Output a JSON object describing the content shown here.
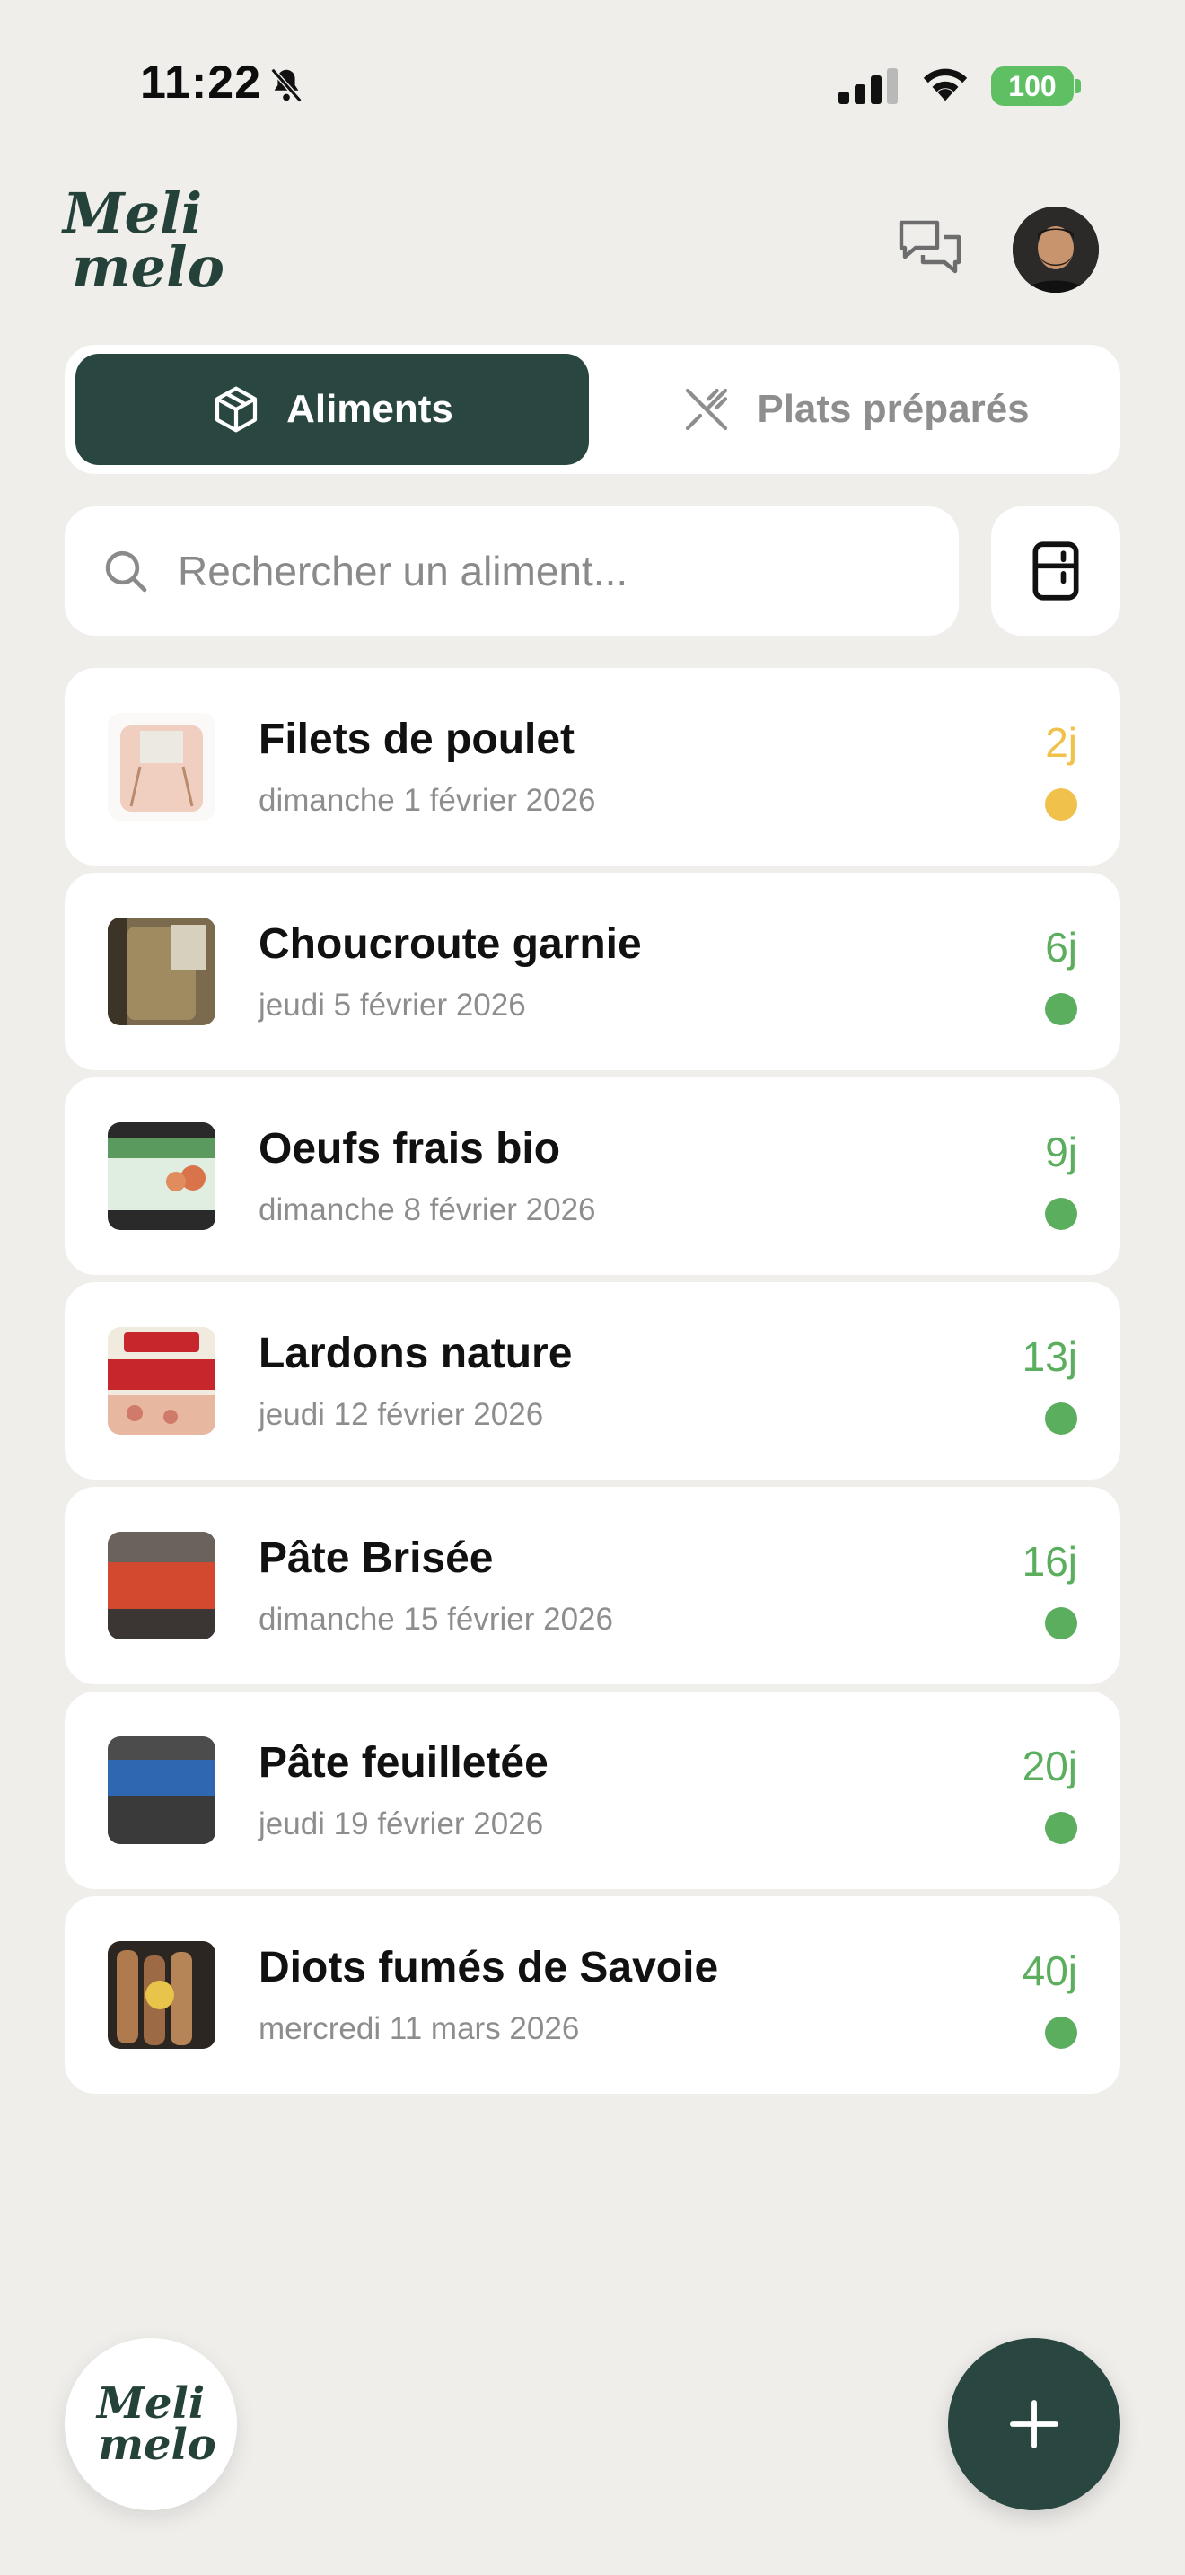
{
  "status_bar": {
    "time": "11:22",
    "battery": "100"
  },
  "header": {
    "logo_line1": "Meli",
    "logo_line2": "melo"
  },
  "tabs": [
    {
      "label": "Aliments",
      "icon": "box-icon",
      "active": true
    },
    {
      "label": "Plats préparés",
      "icon": "utensils-crossed-icon",
      "active": false
    }
  ],
  "search": {
    "placeholder": "Rechercher un aliment..."
  },
  "colors": {
    "accent": "#294740",
    "warning": "#f0c14b",
    "ok": "#5cae5f",
    "background": "#efeeeb"
  },
  "items": [
    {
      "name": "Filets de poulet",
      "date": "dimanche 1 février 2026",
      "days": "2j",
      "status": "warning"
    },
    {
      "name": "Choucroute garnie",
      "date": "jeudi 5 février 2026",
      "days": "6j",
      "status": "ok"
    },
    {
      "name": "Oeufs frais bio",
      "date": "dimanche 8 février 2026",
      "days": "9j",
      "status": "ok"
    },
    {
      "name": "Lardons nature",
      "date": "jeudi 12 février 2026",
      "days": "13j",
      "status": "ok"
    },
    {
      "name": "Pâte Brisée",
      "date": "dimanche 15 février 2026",
      "days": "16j",
      "status": "ok"
    },
    {
      "name": "Pâte feuilletée",
      "date": "jeudi 19 février 2026",
      "days": "20j",
      "status": "ok"
    },
    {
      "name": "Diots fumés de Savoie",
      "date": "mercredi 11 mars 2026",
      "days": "40j",
      "status": "ok"
    }
  ],
  "footer": {
    "logo_line1": "Meli",
    "logo_line2": "melo"
  }
}
